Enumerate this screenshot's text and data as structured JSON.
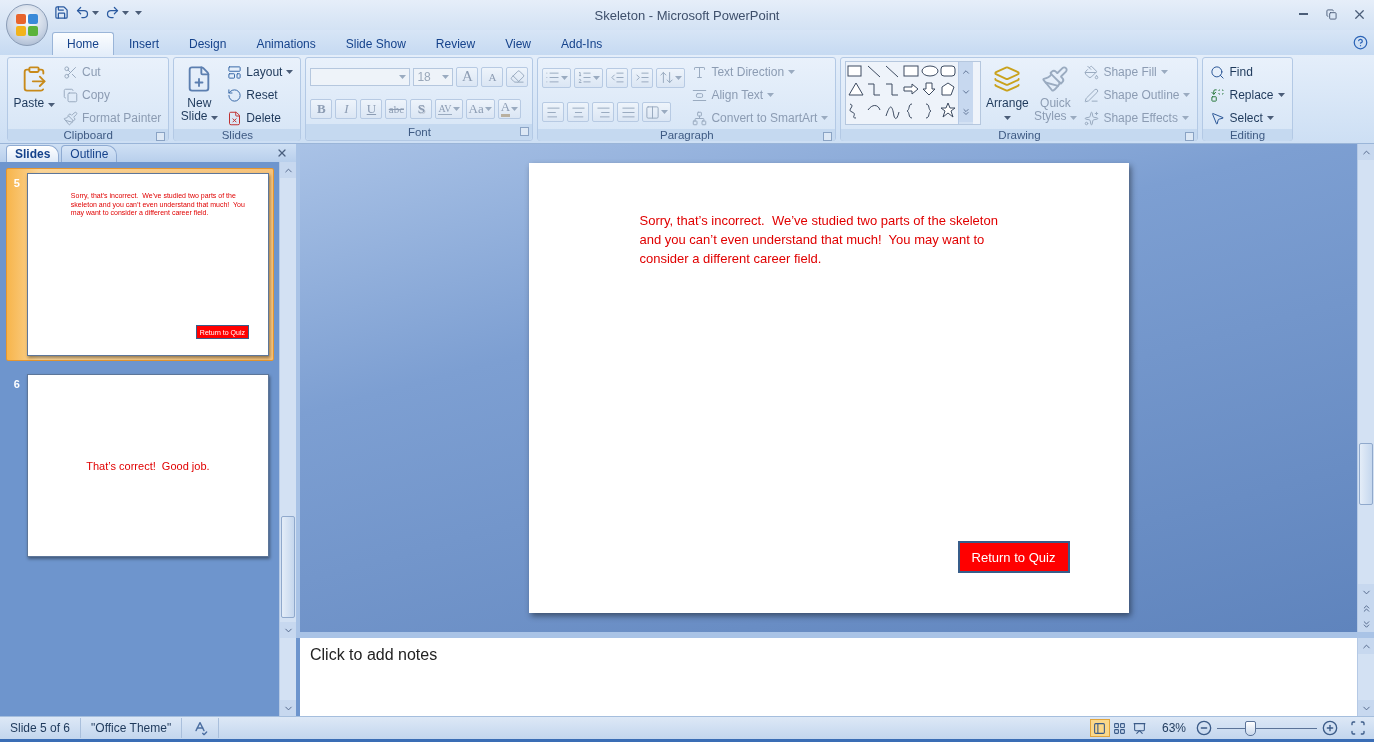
{
  "window": {
    "title": "Skeleton - Microsoft PowerPoint"
  },
  "ribbon_tabs": [
    {
      "label": "Home",
      "selected": true
    },
    {
      "label": "Insert",
      "selected": false
    },
    {
      "label": "Design",
      "selected": false
    },
    {
      "label": "Animations",
      "selected": false
    },
    {
      "label": "Slide Show",
      "selected": false
    },
    {
      "label": "Review",
      "selected": false
    },
    {
      "label": "View",
      "selected": false
    },
    {
      "label": "Add-Ins",
      "selected": false
    }
  ],
  "ribbon_groups": [
    {
      "label": "Clipboard",
      "launcher": true,
      "columns": [
        [
          [
            {
              "kind": "large",
              "label": "Paste",
              "dropdown": true,
              "disabled": false
            }
          ]
        ],
        [
          [
            {
              "kind": "small",
              "label": "Cut",
              "dropdown": false,
              "disabled": true
            }
          ],
          [
            {
              "kind": "small",
              "label": "Copy",
              "dropdown": false,
              "disabled": true
            }
          ],
          [
            {
              "kind": "small",
              "label": "Format Painter",
              "dropdown": false,
              "disabled": true
            }
          ]
        ]
      ]
    },
    {
      "label": "Slides",
      "launcher": false,
      "columns": [
        [
          [
            {
              "kind": "large",
              "label": "New Slide",
              "dropdown": true,
              "disabled": false
            }
          ]
        ],
        [
          [
            {
              "kind": "small",
              "label": "Layout",
              "dropdown": true,
              "disabled": false
            }
          ],
          [
            {
              "kind": "small",
              "label": "Reset",
              "dropdown": false,
              "disabled": false
            }
          ],
          [
            {
              "kind": "small",
              "label": "Delete",
              "dropdown": false,
              "disabled": false
            }
          ]
        ]
      ]
    },
    {
      "label": "Font",
      "launcher": true,
      "columns": [
        [
          [
            {
              "kind": "combo",
              "disabled": true
            },
            {
              "kind": "combo",
              "value": "18",
              "disabled": true
            },
            {
              "kind": "glyph",
              "label": "A",
              "dropdown": false,
              "disabled": true
            },
            {
              "kind": "glyph",
              "label": "A",
              "dropdown": false,
              "disabled": true
            },
            {
              "kind": "tool",
              "dropdown": false,
              "disabled": true
            }
          ],
          [
            {
              "kind": "glyph",
              "label": "B",
              "dropdown": false,
              "disabled": true
            },
            {
              "kind": "glyph",
              "label": "I",
              "dropdown": false,
              "disabled": true
            },
            {
              "kind": "glyph",
              "label": "U",
              "dropdown": false,
              "disabled": true
            },
            {
              "kind": "glyph",
              "label": "abc",
              "dropdown": false,
              "disabled": true
            },
            {
              "kind": "glyph",
              "label": "S",
              "dropdown": false,
              "disabled": true
            },
            {
              "kind": "glyph",
              "label": "AV",
              "dropdown": true,
              "disabled": true
            },
            {
              "kind": "glyph",
              "label": "Aa",
              "dropdown": true,
              "disabled": true
            },
            {
              "kind": "glyph",
              "label": "A",
              "dropdown": true,
              "disabled": true
            }
          ]
        ]
      ]
    },
    {
      "label": "Paragraph",
      "launcher": true,
      "columns": [
        [
          [
            {
              "kind": "tool",
              "dropdown": true,
              "disabled": true
            },
            {
              "kind": "tool",
              "dropdown": true,
              "disabled": true
            },
            {
              "kind": "tool",
              "dropdown": false,
              "disabled": true
            },
            {
              "kind": "tool",
              "dropdown": false,
              "disabled": true
            },
            {
              "kind": "tool",
              "dropdown": true,
              "disabled": true
            }
          ],
          [
            {
              "kind": "tool",
              "dropdown": false,
              "disabled": true
            },
            {
              "kind": "tool",
              "dropdown": false,
              "disabled": true
            },
            {
              "kind": "tool",
              "dropdown": false,
              "disabled": true
            },
            {
              "kind": "tool",
              "dropdown": false,
              "disabled": true
            },
            {
              "kind": "tool",
              "dropdown": true,
              "disabled": true
            }
          ]
        ],
        [
          [
            {
              "kind": "small",
              "label": "Text Direction",
              "dropdown": true,
              "disabled": true
            }
          ],
          [
            {
              "kind": "small",
              "label": "Align Text",
              "dropdown": true,
              "disabled": true
            }
          ],
          [
            {
              "kind": "small",
              "label": "Convert to SmartArt",
              "dropdown": true,
              "disabled": true
            }
          ]
        ]
      ]
    },
    {
      "label": "Drawing",
      "launcher": true,
      "columns": [
        [
          [
            {
              "kind": "gallery",
              "disabled": false
            }
          ]
        ],
        [
          [
            {
              "kind": "large",
              "label": "Arrange",
              "dropdown": true,
              "disabled": false
            }
          ]
        ],
        [
          [
            {
              "kind": "large",
              "label": "Quick Styles",
              "dropdown": true,
              "disabled": true
            }
          ]
        ],
        [
          [
            {
              "kind": "small",
              "label": "Shape Fill",
              "dropdown": true,
              "disabled": true
            }
          ],
          [
            {
              "kind": "small",
              "label": "Shape Outline",
              "dropdown": true,
              "disabled": true
            }
          ],
          [
            {
              "kind": "small",
              "label": "Shape Effects",
              "dropdown": true,
              "disabled": true
            }
          ]
        ]
      ]
    },
    {
      "label": "Editing",
      "launcher": false,
      "columns": [
        [
          [
            {
              "kind": "small",
              "label": "Find",
              "dropdown": false,
              "disabled": false
            }
          ],
          [
            {
              "kind": "small",
              "label": "Replace",
              "dropdown": true,
              "disabled": false
            }
          ],
          [
            {
              "kind": "small",
              "label": "Select",
              "dropdown": true,
              "disabled": false
            }
          ]
        ]
      ]
    }
  ],
  "pane_tabs": [
    {
      "label": "Slides",
      "selected": true
    },
    {
      "label": "Outline",
      "selected": false
    }
  ],
  "thumbnails": [
    {
      "number": "5",
      "selected": true,
      "kind": "message",
      "body": "Sorry, that’s incorrect.  We’ve studied two parts of the skeleton and you can’t even understand that much!  You may want to consider a different career field.",
      "button": "Return to Quiz"
    },
    {
      "number": "6",
      "selected": false,
      "kind": "centered",
      "body": "That’s correct!  Good job."
    }
  ],
  "slide": {
    "kind": "message",
    "body": "Sorry, that’s incorrect.  We’ve studied two parts of the skeleton and you can’t even understand that much!  You may want to consider a different career field.",
    "button": "Return to Quiz"
  },
  "notes": {
    "placeholder": "Click to add notes"
  },
  "status_bar": {
    "slide": "Slide 5 of 6",
    "theme": "\"Office Theme\"",
    "views": [
      {
        "selected": true
      },
      {
        "selected": false
      },
      {
        "selected": false
      }
    ],
    "zoom": {
      "reading": "63%",
      "level": 0.33
    }
  }
}
